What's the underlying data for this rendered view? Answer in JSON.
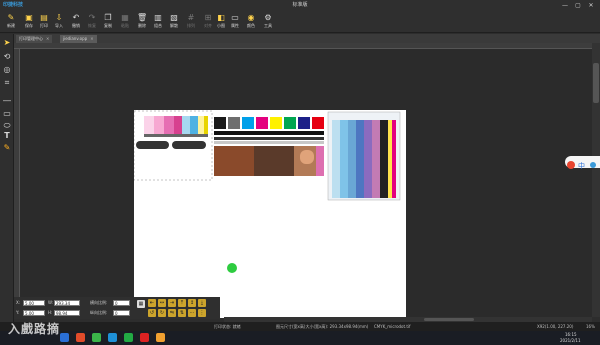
{
  "titlebar": {
    "logo_text": "印捷科技",
    "title": "标准版",
    "min_label": "—",
    "max_label": "▢",
    "close_label": "✕"
  },
  "toolbar": {
    "items": [
      {
        "label": "新建",
        "icon": "new-file-icon"
      },
      {
        "label": "保存",
        "icon": "save-icon"
      },
      {
        "label": "打印",
        "icon": "print-icon"
      },
      {
        "label": "导入",
        "icon": "import-icon"
      },
      {
        "label": "撤销",
        "icon": "undo-icon"
      },
      {
        "label": "恢复",
        "icon": "redo-icon"
      },
      {
        "label": "复制",
        "icon": "copy-icon"
      },
      {
        "label": "粘贴",
        "icon": "paste-icon"
      },
      {
        "label": "删除",
        "icon": "delete-icon"
      },
      {
        "label": "组合",
        "icon": "group-icon"
      },
      {
        "label": "解散",
        "icon": "ungroup-icon"
      },
      {
        "label": "排列",
        "icon": "arrange-icon"
      },
      {
        "label": "对齐",
        "icon": "align-icon"
      },
      {
        "label": "小图",
        "icon": "small-image-icon"
      },
      {
        "label": "属性",
        "icon": "property-icon"
      },
      {
        "label": "颜色",
        "icon": "color-icon"
      },
      {
        "label": "预览",
        "icon": "preview-icon"
      },
      {
        "label": "工具",
        "icon": "tools-icon"
      }
    ]
  },
  "tabs": [
    {
      "label": "打印管理中心",
      "active": false
    },
    {
      "label": "jiedianv.opp",
      "active": true
    }
  ],
  "left_tools": [
    {
      "icon": "select-icon"
    },
    {
      "icon": "rotate-icon"
    },
    {
      "icon": "circle-tool-icon"
    },
    {
      "icon": "crop-icon"
    },
    {
      "icon": "line-tool-icon"
    },
    {
      "icon": "rectangle-tool-icon"
    },
    {
      "icon": "ellipse-tool-icon"
    },
    {
      "icon": "text-tool-icon"
    },
    {
      "icon": "pen-tool-icon"
    }
  ],
  "props": {
    "x_label": "X:",
    "x_value": "5.00",
    "w_label": "W:",
    "w_value": "293.34",
    "y_label": "Y:",
    "y_value": "5.00",
    "h_label": "H:",
    "h_value": "98.94",
    "scale_x_label": "横向比例:",
    "scale_x_value": "0",
    "scale_y_label": "纵向比例:",
    "scale_y_value": "0"
  },
  "status": {
    "print_status": "打印状态: 就绪",
    "size_info": "图元尺寸(宽x高)大小(宽x高): 293.34x98.94(mm)",
    "filename": "CMYK_microdot.tif",
    "coords": "X92(1.00, 227.20)",
    "zoom": "16%"
  },
  "watermark": "入戲路摘",
  "colors": {
    "accent": "#ffd34d",
    "canvas_bg": "#2b2b2b",
    "panel_bg": "#2f2f2f",
    "cyan": "#00a0e9",
    "magenta": "#e4007f",
    "yellow": "#fff100",
    "green_dot": "#2ecc40"
  },
  "clock": {
    "time": "16:15",
    "date": "2021/2/11"
  }
}
